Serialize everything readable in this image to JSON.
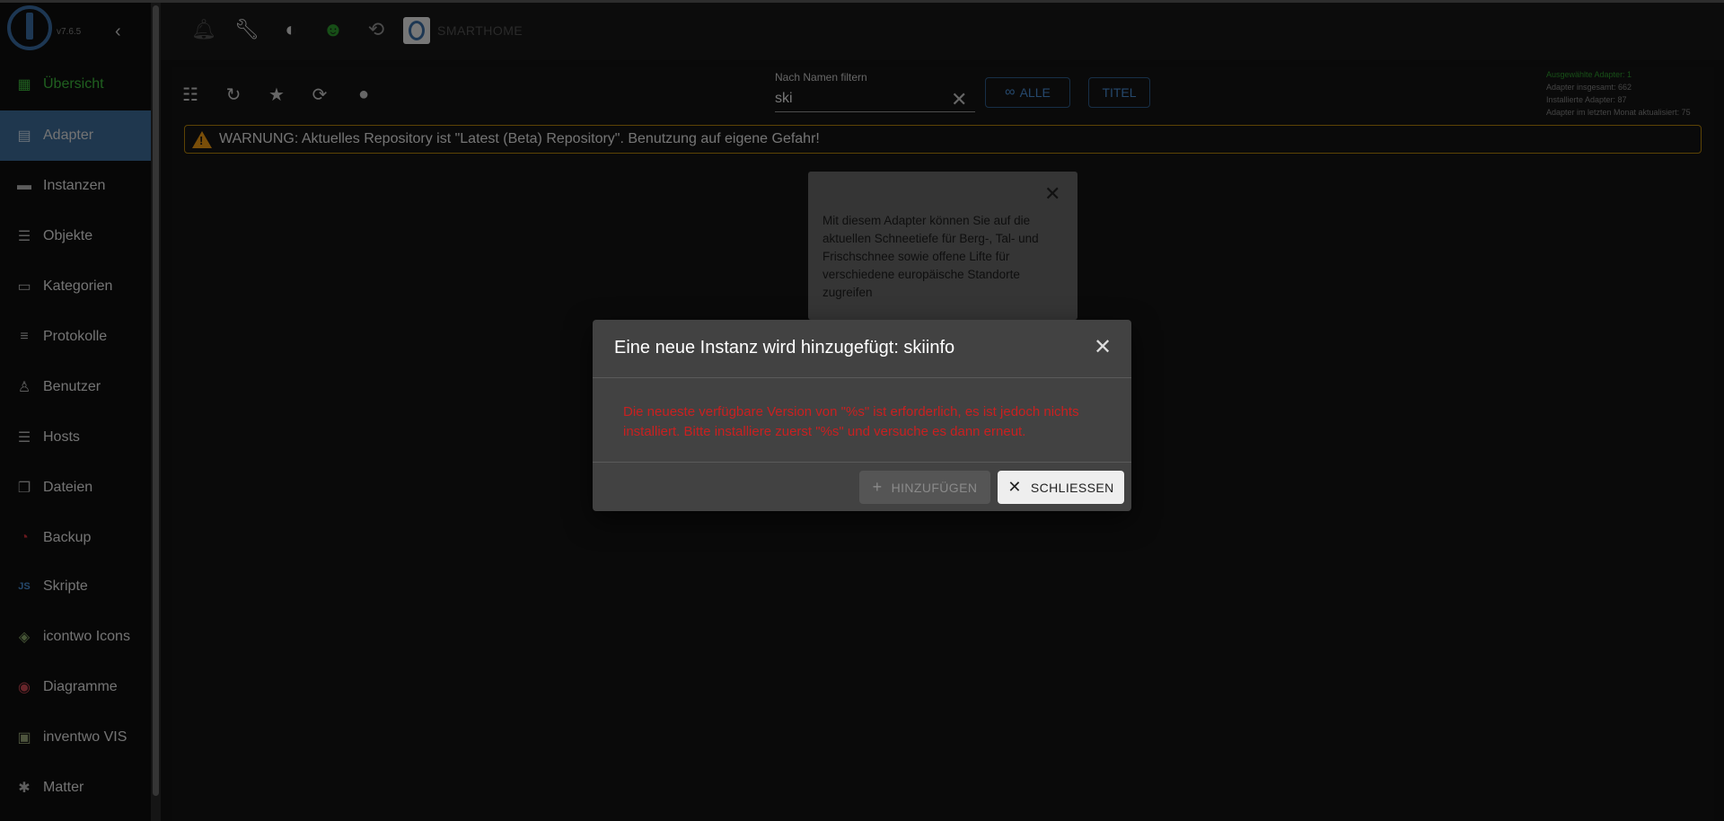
{
  "app": {
    "version": "v7.6.5",
    "brand": "SMARTHOME"
  },
  "sidebar": {
    "items": [
      {
        "label": "Übersicht",
        "icon": "grid-icon"
      },
      {
        "label": "Adapter",
        "icon": "store-icon"
      },
      {
        "label": "Instanzen",
        "icon": "instances-icon"
      },
      {
        "label": "Objekte",
        "icon": "list-icon"
      },
      {
        "label": "Kategorien",
        "icon": "categories-icon"
      },
      {
        "label": "Protokolle",
        "icon": "lines-icon"
      },
      {
        "label": "Benutzer",
        "icon": "user-icon"
      },
      {
        "label": "Hosts",
        "icon": "hosts-icon"
      },
      {
        "label": "Dateien",
        "icon": "files-icon"
      },
      {
        "label": "Backup",
        "icon": "backup-icon"
      },
      {
        "label": "Skripte",
        "icon": "js-icon"
      },
      {
        "label": "icontwo Icons",
        "icon": "icontwo-icon"
      },
      {
        "label": "Diagramme",
        "icon": "chart-icon"
      },
      {
        "label": "inventwo VIS",
        "icon": "vis-icon"
      },
      {
        "label": "Matter",
        "icon": "matter-icon"
      }
    ],
    "active": "Adapter"
  },
  "toolbar": {
    "filter_label": "Nach Namen filtern",
    "filter_value": "ski",
    "all_button": "ALLE",
    "title_button": "TITEL"
  },
  "stats": {
    "selected": "Ausgewählte Adapter: 1",
    "total": "Adapter insgesamt: 662",
    "installed": "Installierte Adapter: 87",
    "updated": "Adapter im letzten Monat aktualisiert: 75"
  },
  "warning": {
    "text": "WARNUNG: Aktuelles Repository ist \"Latest (Beta) Repository\". Benutzung auf eigene Gefahr!"
  },
  "card": {
    "description": "Mit diesem Adapter können Sie auf die aktuellen Schneetiefe für Berg-, Tal- und Frischschnee sowie offene Lifte für verschiedene europäische Standorte zugreifen"
  },
  "dialog": {
    "title": "Eine neue Instanz wird hinzugefügt: skiinfo",
    "message": "Die neueste verfügbare Version von \"%s\" ist erforderlich, es ist jedoch nichts installiert. Bitte installiere zuerst \"%s\" und versuche es dann erneut.",
    "add_button": "HINZUFÜGEN",
    "close_button": "SCHLIESSEN"
  },
  "colors": {
    "accent": "#3e6f9d",
    "warning_border": "#b8860b",
    "error_text": "#c92020",
    "overview_green": "#3fbf3f"
  }
}
